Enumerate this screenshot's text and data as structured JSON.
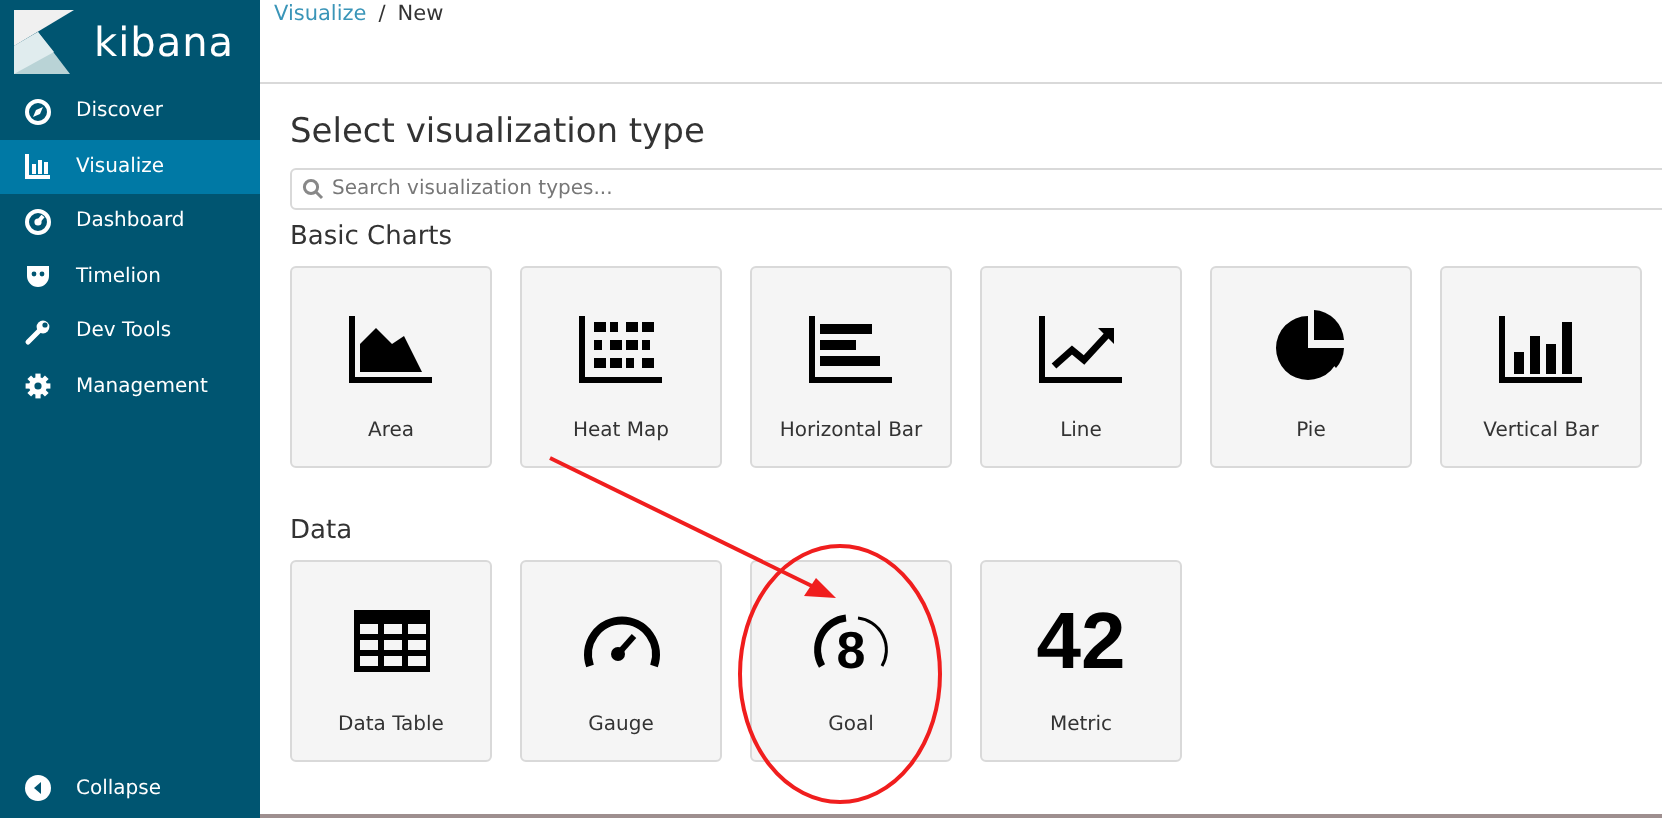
{
  "brand": {
    "name": "kibana"
  },
  "sidebar": {
    "items": [
      {
        "label": "Discover",
        "selected": false
      },
      {
        "label": "Visualize",
        "selected": true
      },
      {
        "label": "Dashboard",
        "selected": false
      },
      {
        "label": "Timelion",
        "selected": false
      },
      {
        "label": "Dev Tools",
        "selected": false
      },
      {
        "label": "Management",
        "selected": false
      }
    ],
    "footer": {
      "label": "Collapse"
    }
  },
  "breadcrumbs": [
    {
      "label": "Visualize",
      "kind": "link"
    },
    {
      "label": "/",
      "kind": "separator"
    },
    {
      "label": "New",
      "kind": "current"
    }
  ],
  "title": "Select visualization type",
  "search": {
    "placeholder": "Search visualization types..."
  },
  "groups": [
    {
      "title": "Basic Charts",
      "cards": [
        {
          "label": "Area"
        },
        {
          "label": "Heat Map"
        },
        {
          "label": "Horizontal Bar"
        },
        {
          "label": "Line"
        },
        {
          "label": "Pie"
        },
        {
          "label": "Vertical Bar"
        }
      ]
    },
    {
      "title": "Data",
      "cards": [
        {
          "label": "Data Table"
        },
        {
          "label": "Gauge"
        },
        {
          "label": "Goal",
          "icon_text": "8"
        },
        {
          "label": "Metric",
          "icon_text": "42"
        }
      ]
    }
  ]
}
